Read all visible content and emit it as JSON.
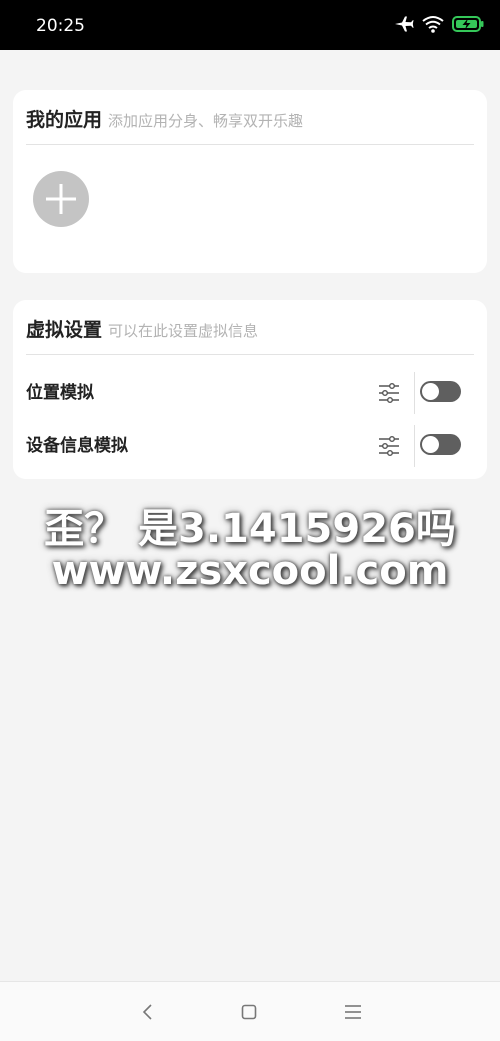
{
  "status_bar": {
    "time": "20:25",
    "icons": [
      "airplane-icon",
      "wifi-icon",
      "battery-charging-icon"
    ],
    "battery_color": "#35c759"
  },
  "my_apps": {
    "title": "我的应用",
    "subtitle": "添加应用分身、畅享双开乐趣",
    "add_icon": "plus-icon"
  },
  "virtual_settings": {
    "title": "虚拟设置",
    "subtitle": "可以在此设置虚拟信息",
    "rows": [
      {
        "label": "位置模拟",
        "enabled": false
      },
      {
        "label": "设备信息模拟",
        "enabled": false
      }
    ]
  },
  "watermark": {
    "line1": "歪？ 是3.1415926吗",
    "line2": "www.zsxcool.com"
  },
  "nav_bar": {
    "icons": [
      "back-icon",
      "home-icon",
      "menu-icon"
    ]
  }
}
